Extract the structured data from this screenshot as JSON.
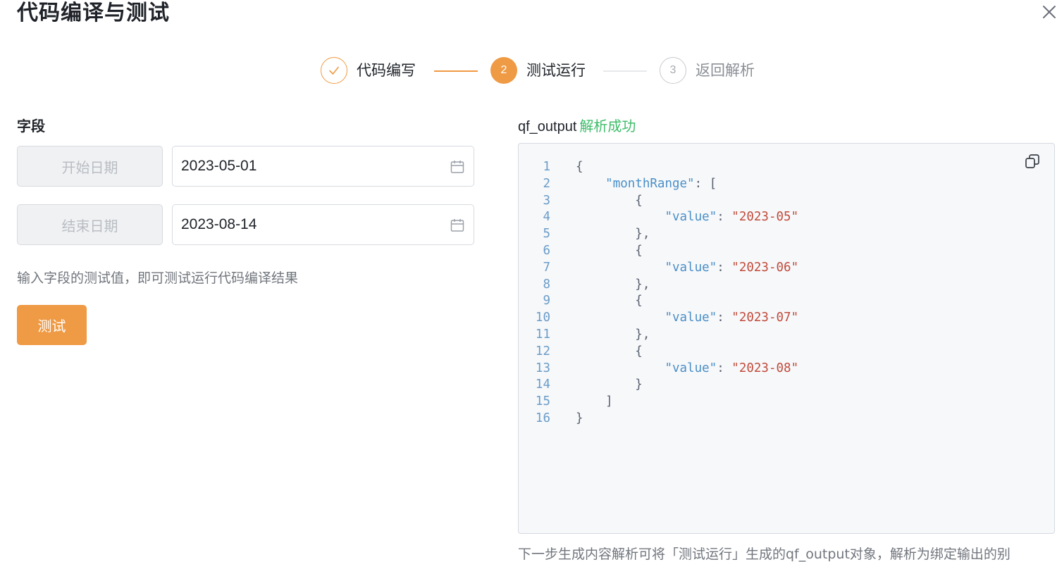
{
  "dialog": {
    "title": "代码编译与测试",
    "close_icon": "close-icon"
  },
  "steps": [
    {
      "number": "1",
      "label": "代码编写",
      "status": "done",
      "icon": "check-icon"
    },
    {
      "number": "2",
      "label": "测试运行",
      "status": "active"
    },
    {
      "number": "3",
      "label": "返回解析",
      "status": "pending"
    }
  ],
  "left": {
    "field_label": "字段",
    "fields": [
      {
        "name": "开始日期",
        "value": "2023-05-01",
        "icon": "calendar-icon"
      },
      {
        "name": "结束日期",
        "value": "2023-08-14",
        "icon": "calendar-icon"
      }
    ],
    "hint": "输入字段的测试值，即可测试运行代码编译结果",
    "test_button": "测试"
  },
  "right": {
    "output_name": "qf_output",
    "output_status": "解析成功",
    "copy_icon": "copy-icon",
    "code_lines": [
      {
        "n": "1",
        "indent": "",
        "parts": [
          {
            "t": "{",
            "c": "tx"
          }
        ]
      },
      {
        "n": "2",
        "indent": "    ",
        "parts": [
          {
            "t": "\"monthRange\"",
            "c": "key"
          },
          {
            "t": ": [",
            "c": "tx"
          }
        ]
      },
      {
        "n": "3",
        "indent": "        ",
        "parts": [
          {
            "t": "{",
            "c": "tx"
          }
        ]
      },
      {
        "n": "4",
        "indent": "            ",
        "parts": [
          {
            "t": "\"value\"",
            "c": "key"
          },
          {
            "t": ": ",
            "c": "tx"
          },
          {
            "t": "\"2023-05\"",
            "c": "str"
          }
        ]
      },
      {
        "n": "5",
        "indent": "        ",
        "parts": [
          {
            "t": "},",
            "c": "tx"
          }
        ]
      },
      {
        "n": "6",
        "indent": "        ",
        "parts": [
          {
            "t": "{",
            "c": "tx"
          }
        ]
      },
      {
        "n": "7",
        "indent": "            ",
        "parts": [
          {
            "t": "\"value\"",
            "c": "key"
          },
          {
            "t": ": ",
            "c": "tx"
          },
          {
            "t": "\"2023-06\"",
            "c": "str"
          }
        ]
      },
      {
        "n": "8",
        "indent": "        ",
        "parts": [
          {
            "t": "},",
            "c": "tx"
          }
        ]
      },
      {
        "n": "9",
        "indent": "        ",
        "parts": [
          {
            "t": "{",
            "c": "tx"
          }
        ]
      },
      {
        "n": "10",
        "indent": "            ",
        "parts": [
          {
            "t": "\"value\"",
            "c": "key"
          },
          {
            "t": ": ",
            "c": "tx"
          },
          {
            "t": "\"2023-07\"",
            "c": "str"
          }
        ]
      },
      {
        "n": "11",
        "indent": "        ",
        "parts": [
          {
            "t": "},",
            "c": "tx"
          }
        ]
      },
      {
        "n": "12",
        "indent": "        ",
        "parts": [
          {
            "t": "{",
            "c": "tx"
          }
        ]
      },
      {
        "n": "13",
        "indent": "            ",
        "parts": [
          {
            "t": "\"value\"",
            "c": "key"
          },
          {
            "t": ": ",
            "c": "tx"
          },
          {
            "t": "\"2023-08\"",
            "c": "str"
          }
        ]
      },
      {
        "n": "14",
        "indent": "        ",
        "parts": [
          {
            "t": "}",
            "c": "tx"
          }
        ]
      },
      {
        "n": "15",
        "indent": "    ",
        "parts": [
          {
            "t": "]",
            "c": "tx"
          }
        ]
      },
      {
        "n": "16",
        "indent": "",
        "parts": [
          {
            "t": "}",
            "c": "tx"
          }
        ]
      }
    ],
    "footer": "下一步生成内容解析可将「测试运行」生成的qf_output对象，解析为绑定输出的别"
  },
  "colors": {
    "accent": "#ef9a44",
    "success": "#3ebd6a",
    "json_key": "#4a8fc7",
    "json_string": "#c14b3b"
  }
}
